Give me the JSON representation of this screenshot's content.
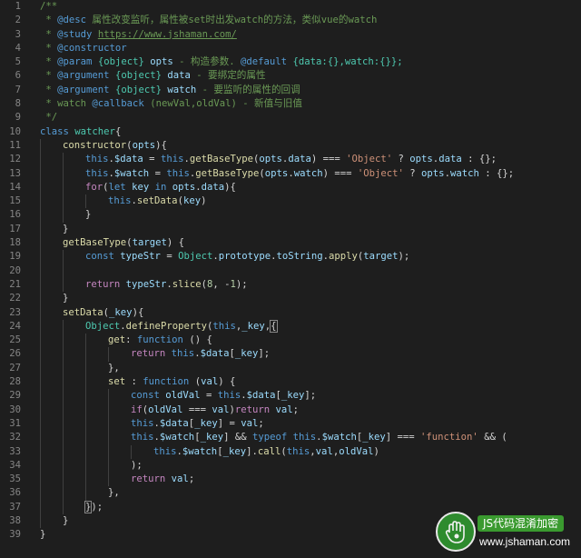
{
  "editor": {
    "lines": [
      {
        "n": "1",
        "indent": 0,
        "t": [
          [
            "c",
            "/**"
          ]
        ]
      },
      {
        "n": "2",
        "indent": 0,
        "t": [
          [
            "c",
            " * "
          ],
          [
            "dt",
            "@desc"
          ],
          [
            "c",
            " 属性改变监听，属性被set时出发watch的方法，类似vue的watch"
          ]
        ]
      },
      {
        "n": "3",
        "indent": 0,
        "t": [
          [
            "c",
            " * "
          ],
          [
            "dt",
            "@study"
          ],
          [
            "c",
            " "
          ],
          [
            "lk",
            "https://www.jshaman.com/"
          ]
        ]
      },
      {
        "n": "4",
        "indent": 0,
        "t": [
          [
            "c",
            " * "
          ],
          [
            "dt",
            "@constructor"
          ]
        ]
      },
      {
        "n": "5",
        "indent": 0,
        "t": [
          [
            "c",
            " * "
          ],
          [
            "dt",
            "@param"
          ],
          [
            "c",
            " "
          ],
          [
            "dy",
            "{object}"
          ],
          [
            "c",
            " "
          ],
          [
            "dp",
            "opts"
          ],
          [
            "c",
            " - 构造参数. "
          ],
          [
            "dt",
            "@default"
          ],
          [
            "c",
            " "
          ],
          [
            "dy",
            "{data:{},watch:{}};"
          ]
        ]
      },
      {
        "n": "6",
        "indent": 0,
        "t": [
          [
            "c",
            " * "
          ],
          [
            "dt",
            "@argument"
          ],
          [
            "c",
            " "
          ],
          [
            "dy",
            "{object}"
          ],
          [
            "c",
            " "
          ],
          [
            "dp",
            "data"
          ],
          [
            "c",
            " - 要绑定的属性"
          ]
        ]
      },
      {
        "n": "7",
        "indent": 0,
        "t": [
          [
            "c",
            " * "
          ],
          [
            "dt",
            "@argument"
          ],
          [
            "c",
            " "
          ],
          [
            "dy",
            "{object}"
          ],
          [
            "c",
            " "
          ],
          [
            "dp",
            "watch"
          ],
          [
            "c",
            " - 要监听的属性的回调"
          ]
        ]
      },
      {
        "n": "8",
        "indent": 0,
        "t": [
          [
            "c",
            " * watch "
          ],
          [
            "dt",
            "@callback"
          ],
          [
            "c",
            " (newVal,oldVal) - 新值与旧值"
          ]
        ]
      },
      {
        "n": "9",
        "indent": 0,
        "t": [
          [
            "c",
            " */"
          ]
        ]
      },
      {
        "n": "10",
        "indent": 0,
        "t": [
          [
            "k",
            "class"
          ],
          [
            "p",
            " "
          ],
          [
            "cl",
            "watcher"
          ],
          [
            "p",
            "{"
          ]
        ]
      },
      {
        "n": "11",
        "indent": 1,
        "t": [
          [
            "f",
            "constructor"
          ],
          [
            "p",
            "("
          ],
          [
            "v",
            "opts"
          ],
          [
            "p",
            "){"
          ]
        ]
      },
      {
        "n": "12",
        "indent": 2,
        "t": [
          [
            "k",
            "this"
          ],
          [
            "p",
            "."
          ],
          [
            "v",
            "$data"
          ],
          [
            "p",
            " = "
          ],
          [
            "k",
            "this"
          ],
          [
            "p",
            "."
          ],
          [
            "f",
            "getBaseType"
          ],
          [
            "p",
            "("
          ],
          [
            "v",
            "opts"
          ],
          [
            "p",
            "."
          ],
          [
            "v",
            "data"
          ],
          [
            "p",
            ") === "
          ],
          [
            "s",
            "'Object'"
          ],
          [
            "p",
            " ? "
          ],
          [
            "v",
            "opts"
          ],
          [
            "p",
            "."
          ],
          [
            "v",
            "data"
          ],
          [
            "p",
            " : {};"
          ]
        ]
      },
      {
        "n": "13",
        "indent": 2,
        "t": [
          [
            "k",
            "this"
          ],
          [
            "p",
            "."
          ],
          [
            "v",
            "$watch"
          ],
          [
            "p",
            " = "
          ],
          [
            "k",
            "this"
          ],
          [
            "p",
            "."
          ],
          [
            "f",
            "getBaseType"
          ],
          [
            "p",
            "("
          ],
          [
            "v",
            "opts"
          ],
          [
            "p",
            "."
          ],
          [
            "v",
            "watch"
          ],
          [
            "p",
            ") === "
          ],
          [
            "s",
            "'Object'"
          ],
          [
            "p",
            " ? "
          ],
          [
            "v",
            "opts"
          ],
          [
            "p",
            "."
          ],
          [
            "v",
            "watch"
          ],
          [
            "p",
            " : {};"
          ]
        ]
      },
      {
        "n": "14",
        "indent": 2,
        "t": [
          [
            "ct",
            "for"
          ],
          [
            "p",
            "("
          ],
          [
            "k",
            "let"
          ],
          [
            "p",
            " "
          ],
          [
            "v",
            "key"
          ],
          [
            "p",
            " "
          ],
          [
            "k",
            "in"
          ],
          [
            "p",
            " "
          ],
          [
            "v",
            "opts"
          ],
          [
            "p",
            "."
          ],
          [
            "v",
            "data"
          ],
          [
            "p",
            "){"
          ]
        ]
      },
      {
        "n": "15",
        "indent": 3,
        "t": [
          [
            "k",
            "this"
          ],
          [
            "p",
            "."
          ],
          [
            "f",
            "setData"
          ],
          [
            "p",
            "("
          ],
          [
            "v",
            "key"
          ],
          [
            "p",
            ")"
          ]
        ]
      },
      {
        "n": "16",
        "indent": 2,
        "t": [
          [
            "p",
            "}"
          ]
        ]
      },
      {
        "n": "17",
        "indent": 1,
        "t": [
          [
            "p",
            "}"
          ]
        ]
      },
      {
        "n": "18",
        "indent": 1,
        "t": [
          [
            "f",
            "getBaseType"
          ],
          [
            "p",
            "("
          ],
          [
            "v",
            "target"
          ],
          [
            "p",
            ") {"
          ]
        ]
      },
      {
        "n": "19",
        "indent": 2,
        "t": [
          [
            "k",
            "const"
          ],
          [
            "p",
            " "
          ],
          [
            "v",
            "typeStr"
          ],
          [
            "p",
            " = "
          ],
          [
            "cl",
            "Object"
          ],
          [
            "p",
            "."
          ],
          [
            "v",
            "prototype"
          ],
          [
            "p",
            "."
          ],
          [
            "v",
            "toString"
          ],
          [
            "p",
            "."
          ],
          [
            "f",
            "apply"
          ],
          [
            "p",
            "("
          ],
          [
            "v",
            "target"
          ],
          [
            "p",
            ");"
          ]
        ]
      },
      {
        "n": "20",
        "indent": 2,
        "t": []
      },
      {
        "n": "21",
        "indent": 2,
        "t": [
          [
            "ct",
            "return"
          ],
          [
            "p",
            " "
          ],
          [
            "v",
            "typeStr"
          ],
          [
            "p",
            "."
          ],
          [
            "f",
            "slice"
          ],
          [
            "p",
            "("
          ],
          [
            "nm",
            "8"
          ],
          [
            "p",
            ", -"
          ],
          [
            "nm",
            "1"
          ],
          [
            "p",
            ");"
          ]
        ]
      },
      {
        "n": "22",
        "indent": 1,
        "t": [
          [
            "p",
            "}"
          ]
        ]
      },
      {
        "n": "23",
        "indent": 1,
        "t": [
          [
            "f",
            "setData"
          ],
          [
            "p",
            "("
          ],
          [
            "v",
            "_key"
          ],
          [
            "p",
            "){"
          ]
        ]
      },
      {
        "n": "24",
        "indent": 2,
        "t": [
          [
            "cl",
            "Object"
          ],
          [
            "p",
            "."
          ],
          [
            "f",
            "defineProperty"
          ],
          [
            "p",
            "("
          ],
          [
            "k",
            "this"
          ],
          [
            "p",
            ","
          ],
          [
            "v",
            "_key"
          ],
          [
            "p",
            ","
          ],
          [
            "br",
            "{"
          ]
        ]
      },
      {
        "n": "25",
        "indent": 3,
        "t": [
          [
            "f",
            "get"
          ],
          [
            "p",
            ": "
          ],
          [
            "k",
            "function"
          ],
          [
            "p",
            " () {"
          ]
        ]
      },
      {
        "n": "26",
        "indent": 4,
        "t": [
          [
            "ct",
            "return"
          ],
          [
            "p",
            " "
          ],
          [
            "k",
            "this"
          ],
          [
            "p",
            "."
          ],
          [
            "v",
            "$data"
          ],
          [
            "p",
            "["
          ],
          [
            "v",
            "_key"
          ],
          [
            "p",
            "];"
          ]
        ]
      },
      {
        "n": "27",
        "indent": 3,
        "t": [
          [
            "p",
            "},"
          ]
        ]
      },
      {
        "n": "28",
        "indent": 3,
        "t": [
          [
            "f",
            "set"
          ],
          [
            "p",
            " : "
          ],
          [
            "k",
            "function"
          ],
          [
            "p",
            " ("
          ],
          [
            "v",
            "val"
          ],
          [
            "p",
            ") {"
          ]
        ]
      },
      {
        "n": "29",
        "indent": 4,
        "t": [
          [
            "k",
            "const"
          ],
          [
            "p",
            " "
          ],
          [
            "v",
            "oldVal"
          ],
          [
            "p",
            " = "
          ],
          [
            "k",
            "this"
          ],
          [
            "p",
            "."
          ],
          [
            "v",
            "$data"
          ],
          [
            "p",
            "["
          ],
          [
            "v",
            "_key"
          ],
          [
            "p",
            "];"
          ]
        ]
      },
      {
        "n": "30",
        "indent": 4,
        "t": [
          [
            "ct",
            "if"
          ],
          [
            "p",
            "("
          ],
          [
            "v",
            "oldVal"
          ],
          [
            "p",
            " === "
          ],
          [
            "v",
            "val"
          ],
          [
            "p",
            ")"
          ],
          [
            "ct",
            "return"
          ],
          [
            "p",
            " "
          ],
          [
            "v",
            "val"
          ],
          [
            "p",
            ";"
          ]
        ]
      },
      {
        "n": "31",
        "indent": 4,
        "t": [
          [
            "k",
            "this"
          ],
          [
            "p",
            "."
          ],
          [
            "v",
            "$data"
          ],
          [
            "p",
            "["
          ],
          [
            "v",
            "_key"
          ],
          [
            "p",
            "] = "
          ],
          [
            "v",
            "val"
          ],
          [
            "p",
            ";"
          ]
        ]
      },
      {
        "n": "32",
        "indent": 4,
        "t": [
          [
            "k",
            "this"
          ],
          [
            "p",
            "."
          ],
          [
            "v",
            "$watch"
          ],
          [
            "p",
            "["
          ],
          [
            "v",
            "_key"
          ],
          [
            "p",
            "] && "
          ],
          [
            "k",
            "typeof"
          ],
          [
            "p",
            " "
          ],
          [
            "k",
            "this"
          ],
          [
            "p",
            "."
          ],
          [
            "v",
            "$watch"
          ],
          [
            "p",
            "["
          ],
          [
            "v",
            "_key"
          ],
          [
            "p",
            "] === "
          ],
          [
            "s",
            "'function'"
          ],
          [
            "p",
            " && ("
          ]
        ]
      },
      {
        "n": "33",
        "indent": 5,
        "t": [
          [
            "k",
            "this"
          ],
          [
            "p",
            "."
          ],
          [
            "v",
            "$watch"
          ],
          [
            "p",
            "["
          ],
          [
            "v",
            "_key"
          ],
          [
            "p",
            "]."
          ],
          [
            "f",
            "call"
          ],
          [
            "p",
            "("
          ],
          [
            "k",
            "this"
          ],
          [
            "p",
            ","
          ],
          [
            "v",
            "val"
          ],
          [
            "p",
            ","
          ],
          [
            "v",
            "oldVal"
          ],
          [
            "p",
            ")"
          ]
        ]
      },
      {
        "n": "34",
        "indent": 4,
        "t": [
          [
            "p",
            ");"
          ]
        ]
      },
      {
        "n": "35",
        "indent": 4,
        "t": [
          [
            "ct",
            "return"
          ],
          [
            "p",
            " "
          ],
          [
            "v",
            "val"
          ],
          [
            "p",
            ";"
          ]
        ]
      },
      {
        "n": "36",
        "indent": 3,
        "t": [
          [
            "p",
            "},"
          ]
        ]
      },
      {
        "n": "37",
        "indent": 2,
        "t": [
          [
            "br",
            "}"
          ],
          [
            "p",
            ");"
          ]
        ]
      },
      {
        "n": "38",
        "indent": 1,
        "t": [
          [
            "p",
            "}"
          ]
        ]
      },
      {
        "n": "39",
        "indent": 0,
        "t": [
          [
            "p",
            "}"
          ]
        ]
      }
    ]
  },
  "watermark": {
    "title": "JS代码混淆加密",
    "url": "www.jshaman.com",
    "logo_icon": "hand-icon",
    "brand_color": "#3a9a2f"
  },
  "colors": {
    "background": "#1e1e1e",
    "line_number": "#858585",
    "comment": "#6a9955",
    "keyword": "#569cd6",
    "string": "#ce9178"
  }
}
